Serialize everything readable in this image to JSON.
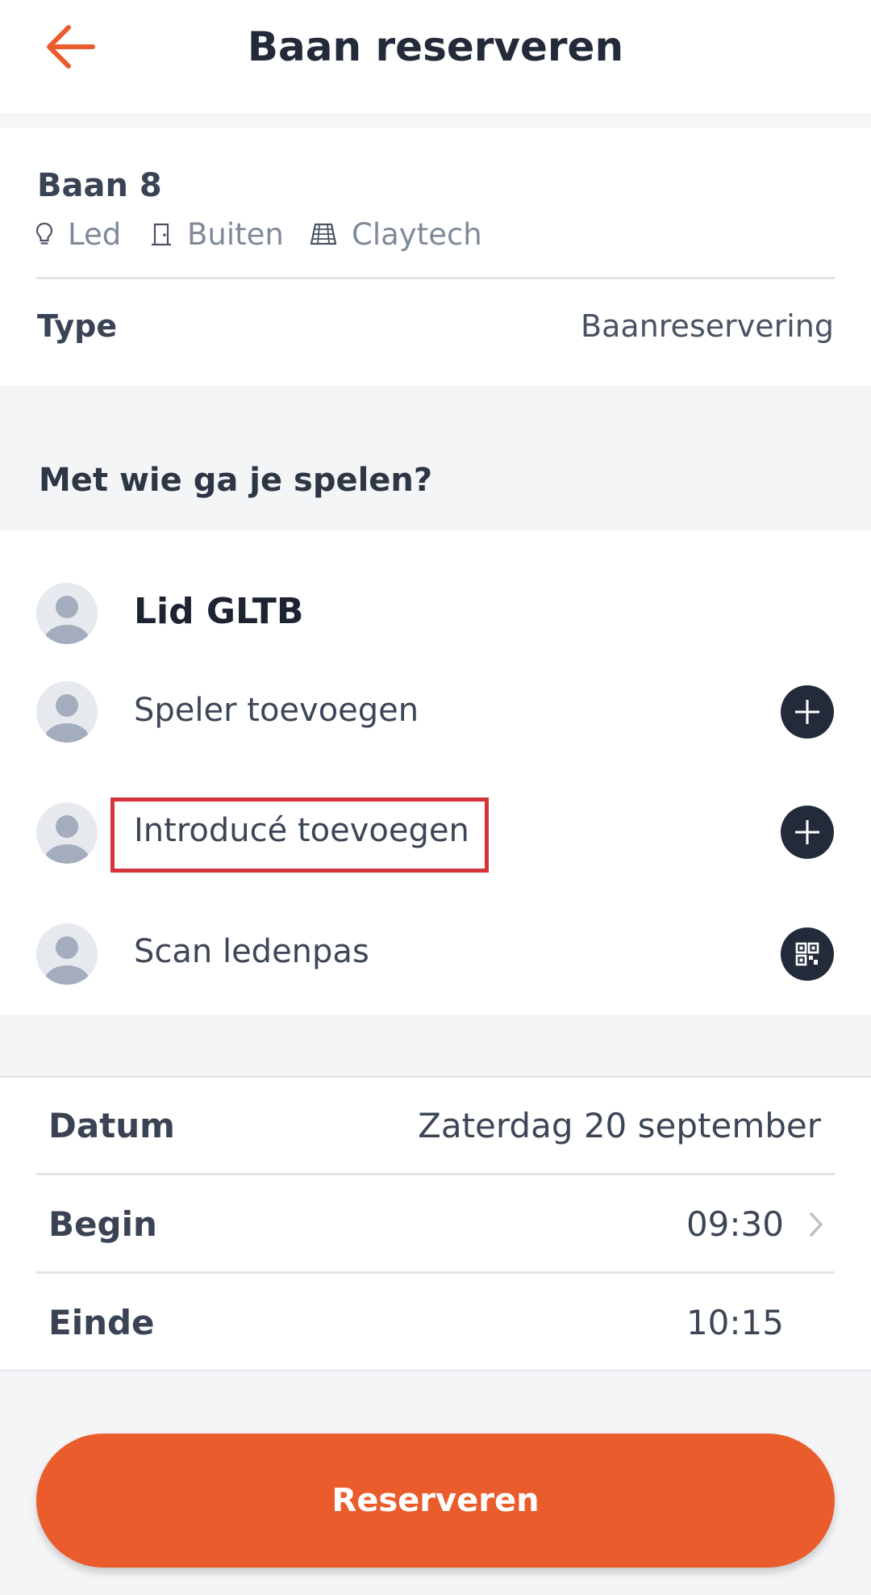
{
  "header": {
    "title": "Baan reserveren",
    "back_icon": "arrow-left-icon"
  },
  "court": {
    "name": "Baan 8",
    "features": [
      {
        "icon": "lightbulb-icon",
        "label": "Led"
      },
      {
        "icon": "door-icon",
        "label": "Buiten"
      },
      {
        "icon": "court-icon",
        "label": "Claytech"
      }
    ],
    "type_label": "Type",
    "type_value": "Baanreservering"
  },
  "players": {
    "heading": "Met wie ga je spelen?",
    "main_player": "Lid GLTB",
    "actions": [
      {
        "label": "Speler toevoegen",
        "icon": "plus-icon"
      },
      {
        "label": "Introducé toevoegen",
        "icon": "plus-icon"
      },
      {
        "label": "Scan ledenpas",
        "icon": "qr-code-icon"
      }
    ]
  },
  "schedule": {
    "date_label": "Datum",
    "date_value": "Zaterdag 20 september",
    "begin_label": "Begin",
    "begin_value": "09:30",
    "end_label": "Einde",
    "end_value": "10:15"
  },
  "reserve_button": "Reserveren",
  "colors": {
    "accent": "#ea5c2b",
    "dark": "#232b3b",
    "highlight": "#d6343a"
  }
}
